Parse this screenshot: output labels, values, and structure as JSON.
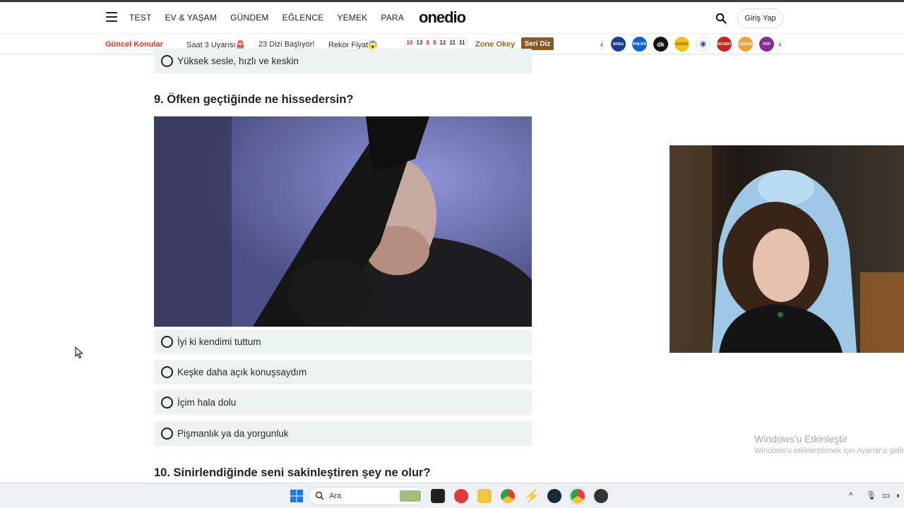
{
  "nav": {
    "links": [
      "TEST",
      "EV & YAŞAM",
      "GÜNDEM",
      "EĞLENCE",
      "YEMEK",
      "PARA"
    ],
    "logo": "onedio",
    "login": "Giriş Yap"
  },
  "subbar": {
    "guncel": "Güncel Konular",
    "items": [
      "Saat 3 Uyarısı🚨",
      "23 Dizi Başlıyor!",
      "Rekor Fiyat😱"
    ],
    "calendar": [
      "10",
      "13",
      "8",
      "9",
      "12",
      "11",
      "11"
    ],
    "zone": "Zone Okey",
    "seri": "Seri Diz",
    "brands": [
      "NIVEA",
      "PHILIPS",
      "dk",
      "KOTEX",
      "✳",
      "REVERY",
      "CERAVE",
      "POP"
    ]
  },
  "prev_option": "Yüksek sesle, hızlı ve keskin",
  "question9": {
    "title": "9. Öfken geçtiğinde ne hissedersin?",
    "options": [
      "İyi ki kendimi tuttum",
      "Keşke daha açık konuşsaydım",
      "İçim hala dolu",
      "Pişmanlık ya da yorgunluk"
    ]
  },
  "question10": {
    "title": "10. Sinirlendiğinde seni sakinleştiren şey ne olur?"
  },
  "watermark": {
    "title": "Windows'u Etkinleştir",
    "subtitle": "Windows'u etkinleştirmek için Ayarlar'a gidin."
  },
  "taskbar": {
    "search_placeholder": "Ara"
  },
  "colors": {
    "accent_red": "#e2361f",
    "option_bg": "#edf3f0",
    "zone_brown": "#8a5a26"
  }
}
